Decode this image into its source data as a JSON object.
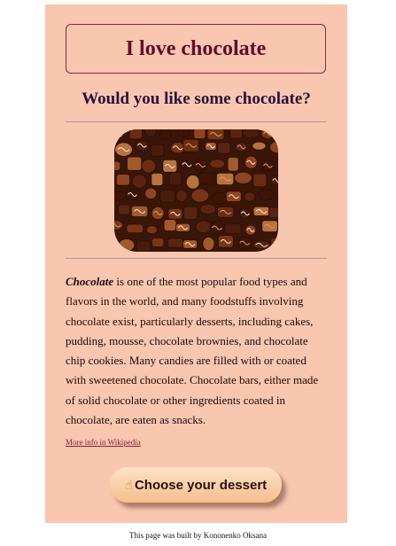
{
  "page": {
    "title": "I love chocolate",
    "subtitle": "Would you like some chocolate?",
    "image_alt": "chocolate candies"
  },
  "article": {
    "lead_word": "Chocolate",
    "body": " is one of the most popular food types and flavors in the world, and many foodstuffs involving chocolate exist, particularly desserts, including cakes, pudding, mousse, chocolate brownies, and chocolate chip cookies. Many candies are filled with or coated with sweetened chocolate. Chocolate bars, either made of solid chocolate or other ingredients coated in chocolate, are eaten as snacks.",
    "more_link": "More info in Wikipedia"
  },
  "cta": {
    "icon": "pointing-hand-icon",
    "label": "Choose your dessert"
  },
  "footer": {
    "credit": "This page was built by Kononenko Oksana"
  },
  "colors": {
    "card_background": "#f9c6b0",
    "title_color": "#5e0f2e",
    "link_color": "#8b1e3a",
    "button_top": "#fce3c8",
    "button_bottom": "#f7be8c"
  }
}
